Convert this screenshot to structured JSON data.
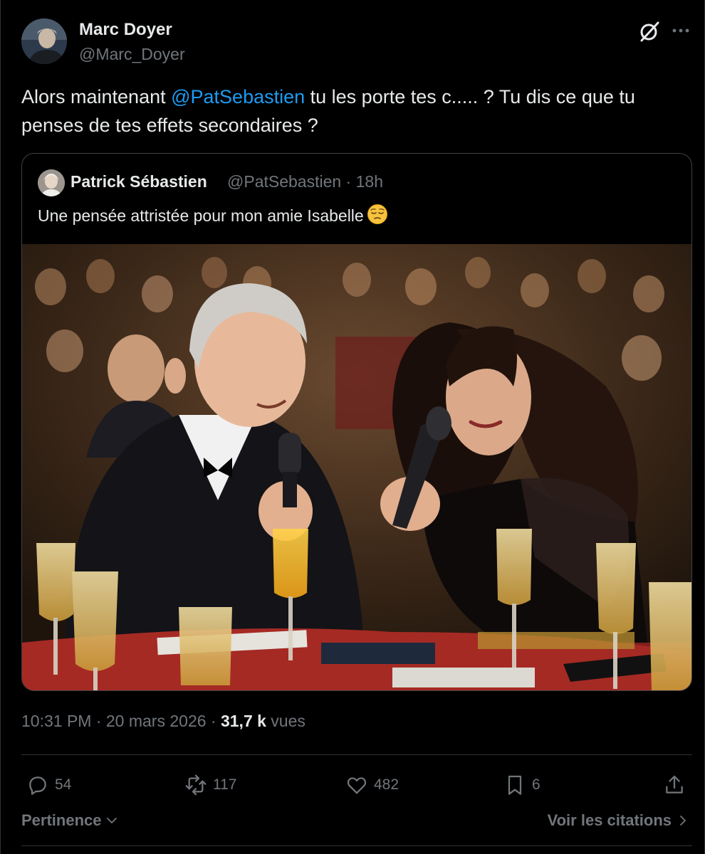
{
  "author": {
    "name": "Marc Doyer",
    "handle": "@Marc_Doyer"
  },
  "tweet": {
    "text_before": "Alors maintenant ",
    "mention": "@PatSebastien",
    "text_after": " tu les porte tes c..... ? Tu dis ce que tu penses de tes effets secondaires ?"
  },
  "quoted": {
    "name": "Patrick Sébastien",
    "meta": "@PatSebastien · 18h",
    "text": "Une pensée attristée pour mon amie Isabelle",
    "emoji": "pensive-face-emoji"
  },
  "meta": {
    "time": "10:31 PM · 20 mars 2026 · ",
    "views_count": "31,7 k",
    "views_label": " vues"
  },
  "actions": {
    "replies": "54",
    "reposts": "117",
    "likes": "482",
    "bookmarks": "6"
  },
  "footer": {
    "sort_label": "Pertinence",
    "quotes_link": "Voir les citations"
  },
  "icons": [
    "grok-icon",
    "more-icon",
    "reply-icon",
    "repost-icon",
    "like-icon",
    "bookmark-icon",
    "share-icon",
    "chevron-down-icon",
    "chevron-right-icon"
  ],
  "colors": {
    "background": "#000000",
    "text": "#e7e9ea",
    "secondary": "#71767b",
    "accent": "#1d9bf0",
    "border": "#2f3336"
  }
}
